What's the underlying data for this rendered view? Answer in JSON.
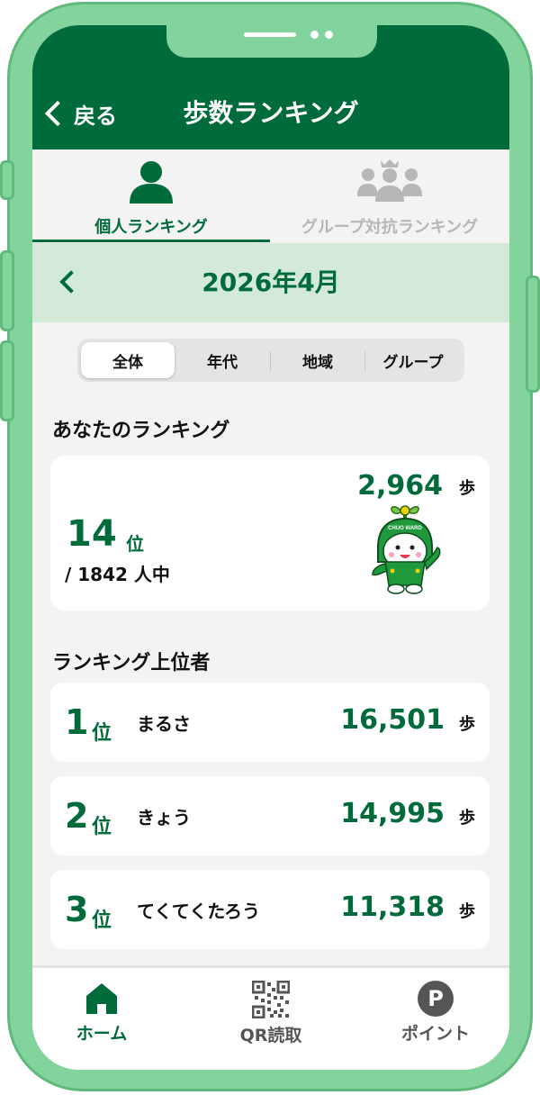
{
  "header": {
    "back_label": "戻る",
    "title": "歩数ランキング"
  },
  "tabs": [
    {
      "label": "個人ランキング",
      "icon": "person-icon",
      "active": true
    },
    {
      "label": "グループ対抗ランキング",
      "icon": "group-icon",
      "active": false
    }
  ],
  "month": {
    "label": "2026年4月"
  },
  "filters": [
    {
      "label": "全体",
      "active": true
    },
    {
      "label": "年代",
      "active": false
    },
    {
      "label": "地域",
      "active": false
    },
    {
      "label": "グループ",
      "active": false
    }
  ],
  "my_ranking": {
    "section_title": "あなたのランキング",
    "rank": "14",
    "rank_unit": "位",
    "total_text": "/ 1842 人中",
    "steps": "2,964",
    "steps_unit": "歩",
    "mascot_badge": "CHUO WARD"
  },
  "leaderboard": {
    "section_title": "ランキング上位者",
    "rows": [
      {
        "rank": "1",
        "rank_unit": "位",
        "name": "まるさ",
        "steps": "16,501",
        "steps_unit": "歩"
      },
      {
        "rank": "2",
        "rank_unit": "位",
        "name": "きょう",
        "steps": "14,995",
        "steps_unit": "歩"
      },
      {
        "rank": "3",
        "rank_unit": "位",
        "name": "てくてくたろう",
        "steps": "11,318",
        "steps_unit": "歩"
      }
    ]
  },
  "bottom_nav": [
    {
      "label": "ホーム",
      "icon": "home-icon",
      "active": true
    },
    {
      "label": "QR読取",
      "icon": "qr-code-icon",
      "active": false
    },
    {
      "label": "ポイント",
      "icon": "point-icon",
      "icon_text": "P",
      "active": false
    }
  ],
  "colors": {
    "brand": "#006b3a",
    "frame": "#82d49c",
    "month_bar": "#d3ead9",
    "inactive": "#b7b7b7"
  }
}
